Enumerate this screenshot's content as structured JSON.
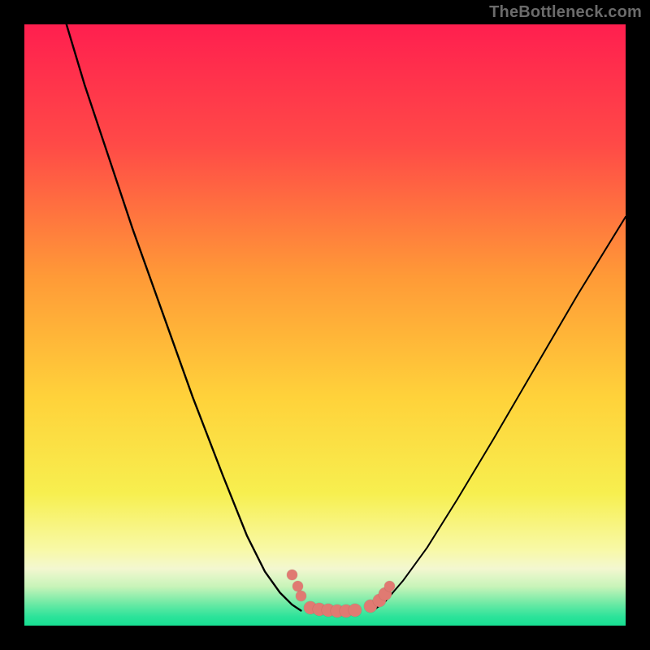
{
  "watermark": "TheBottleneck.com",
  "colors": {
    "frame_bg": "#000000",
    "dot": "#e07a72",
    "curve": "#000000",
    "gradient_stops": [
      {
        "offset": 0,
        "color": "#ff1f4f"
      },
      {
        "offset": 0.2,
        "color": "#ff4a47"
      },
      {
        "offset": 0.42,
        "color": "#ff9a37"
      },
      {
        "offset": 0.62,
        "color": "#ffd23a"
      },
      {
        "offset": 0.78,
        "color": "#f7ef4f"
      },
      {
        "offset": 0.875,
        "color": "#f8f9a8"
      },
      {
        "offset": 0.905,
        "color": "#f3f7d0"
      },
      {
        "offset": 0.935,
        "color": "#c8f4b9"
      },
      {
        "offset": 0.965,
        "color": "#68e9a4"
      },
      {
        "offset": 0.985,
        "color": "#2ce39a"
      },
      {
        "offset": 1.0,
        "color": "#17df92"
      }
    ]
  },
  "chart_data": {
    "type": "line",
    "title": "",
    "xlabel": "",
    "ylabel": "",
    "xlim": [
      0,
      100
    ],
    "ylim": [
      0,
      100
    ],
    "grid": false,
    "legend": false,
    "series": [
      {
        "name": "left-curve",
        "x": [
          7,
          10,
          14,
          18,
          23,
          28,
          33,
          37,
          40,
          42.5,
          44.5,
          46
        ],
        "y": [
          100,
          90,
          78,
          66,
          52,
          38,
          25,
          15,
          9,
          5.5,
          3.5,
          2.5
        ]
      },
      {
        "name": "right-curve",
        "x": [
          58,
          60,
          63,
          67,
          72,
          78,
          85,
          92,
          100
        ],
        "y": [
          2.5,
          4,
          7.5,
          13,
          21,
          31,
          43,
          55,
          68
        ]
      },
      {
        "name": "floor-connection",
        "x": [
          46,
          49,
          52,
          55,
          58
        ],
        "y": [
          2.5,
          2.5,
          2.5,
          2.5,
          2.5
        ]
      }
    ],
    "floor_dots": {
      "comment": "salmon markers near bottom of valley",
      "points": [
        {
          "x": 44.5,
          "y": 8.5,
          "size": "small"
        },
        {
          "x": 45.5,
          "y": 6.5,
          "size": "small"
        },
        {
          "x": 46.0,
          "y": 5.0,
          "size": "small"
        },
        {
          "x": 47.5,
          "y": 3.0,
          "size": "normal"
        },
        {
          "x": 49.0,
          "y": 2.7,
          "size": "normal"
        },
        {
          "x": 50.5,
          "y": 2.6,
          "size": "normal"
        },
        {
          "x": 52.0,
          "y": 2.5,
          "size": "normal"
        },
        {
          "x": 53.5,
          "y": 2.5,
          "size": "normal"
        },
        {
          "x": 55.0,
          "y": 2.6,
          "size": "normal"
        },
        {
          "x": 57.5,
          "y": 3.2,
          "size": "normal"
        },
        {
          "x": 59.0,
          "y": 4.2,
          "size": "normal"
        },
        {
          "x": 60.0,
          "y": 5.3,
          "size": "normal"
        },
        {
          "x": 60.7,
          "y": 6.5,
          "size": "small"
        }
      ]
    }
  }
}
